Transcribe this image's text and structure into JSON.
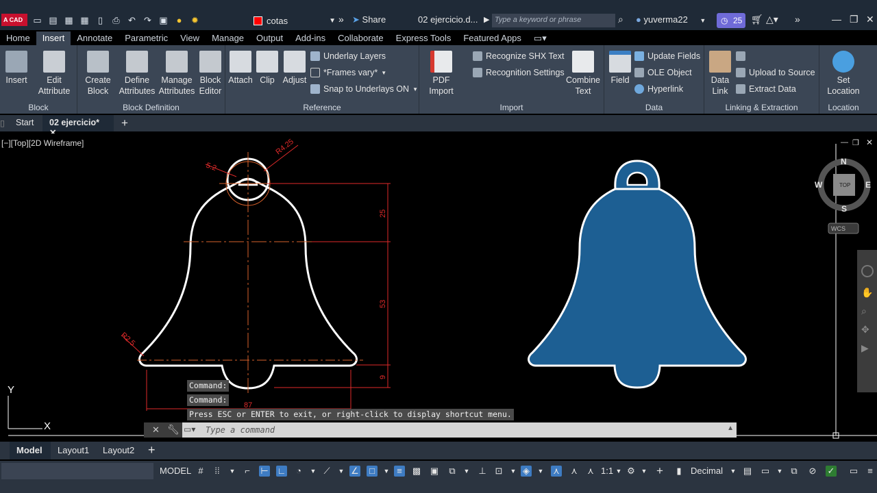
{
  "app": {
    "logo": "A CAD"
  },
  "titlebar": {
    "layer_name": "cotas",
    "share_label": "Share",
    "file_name": "02 ejercicio.d...",
    "search_placeholder": "Type a keyword or phrase",
    "user_name": "yuverma22",
    "badge_count": "25"
  },
  "menu_tabs": [
    "Home",
    "Insert",
    "Annotate",
    "Parametric",
    "View",
    "Manage",
    "Output",
    "Add-ins",
    "Collaborate",
    "Express Tools",
    "Featured Apps"
  ],
  "active_tab": "Insert",
  "ribbon": {
    "block": {
      "title": "Block",
      "insert": "Insert",
      "edit_attribute_1": "Edit",
      "edit_attribute_2": "Attribute"
    },
    "block_definition": {
      "title": "Block Definition",
      "create_1": "Create",
      "create_2": "Block",
      "define_1": "Define",
      "define_2": "Attributes",
      "manage_1": "Manage",
      "manage_2": "Attributes",
      "editor_1": "Block",
      "editor_2": "Editor"
    },
    "reference": {
      "title": "Reference",
      "attach": "Attach",
      "clip": "Clip",
      "adjust": "Adjust",
      "underlay_layers": "Underlay Layers",
      "frames": "*Frames vary*",
      "snap": "Snap to Underlays ON"
    },
    "import": {
      "title": "Import",
      "pdf_1": "PDF",
      "pdf_2": "Import",
      "recognize": "Recognize SHX Text",
      "recognition_settings": "Recognition Settings",
      "combine_1": "Combine",
      "combine_2": "Text"
    },
    "data": {
      "title": "Data",
      "field": "Field",
      "update_fields": "Update Fields",
      "ole": "OLE Object",
      "hyperlink": "Hyperlink"
    },
    "linking": {
      "title": "Linking & Extraction",
      "data_link_1": "Data",
      "data_link_2": "Link",
      "upload": "Upload to Source",
      "extract": "Extract  Data"
    },
    "location": {
      "title": "Location",
      "set_1": "Set",
      "set_2": "Location"
    }
  },
  "doc_tabs": {
    "start": "Start",
    "current": "02 ejercicio*"
  },
  "viewport": {
    "label": "[−][Top][2D Wireframe]",
    "dims": {
      "d52": "5.2",
      "r425": "R4.25",
      "d25": "25",
      "d53": "53",
      "d9": "9",
      "r25": "R2.5",
      "d87": "87"
    },
    "viewcube": {
      "n": "N",
      "s": "S",
      "e": "E",
      "w": "W",
      "top": "TOP",
      "wcs": "WCS"
    },
    "ucs": {
      "x": "X",
      "y": "Y"
    }
  },
  "command": {
    "history": [
      "Command:",
      "Command:",
      "Press ESC or ENTER to exit, or right-click to display shortcut menu."
    ],
    "placeholder": "Type a command"
  },
  "layout_tabs": [
    "Model",
    "Layout1",
    "Layout2"
  ],
  "status": {
    "model": "MODEL",
    "scale": "1:1",
    "units": "Decimal"
  },
  "colors": {
    "ribbon": "#3b4655",
    "bell_fill": "#1d5f93",
    "dim_red": "#e02a2a",
    "center_orange": "#d9622b"
  }
}
